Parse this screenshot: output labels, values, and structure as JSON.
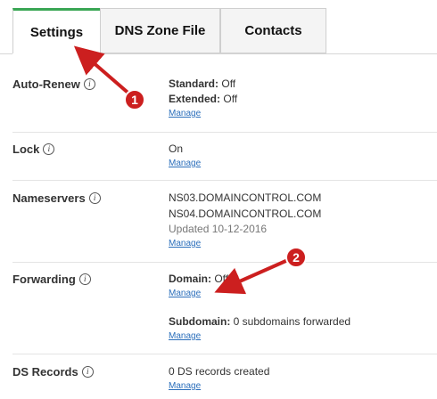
{
  "tabs": [
    {
      "label": "Settings"
    },
    {
      "label": "DNS Zone File"
    },
    {
      "label": "Contacts"
    }
  ],
  "info_glyph": "i",
  "rows": {
    "auto_renew": {
      "label": "Auto-Renew",
      "standard_label": "Standard:",
      "standard_value": "Off",
      "extended_label": "Extended:",
      "extended_value": "Off",
      "manage": "Manage"
    },
    "lock": {
      "label": "Lock",
      "value": "On",
      "manage": "Manage"
    },
    "nameservers": {
      "label": "Nameservers",
      "ns1": "NS03.DOMAINCONTROL.COM",
      "ns2": "NS04.DOMAINCONTROL.COM",
      "updated": "Updated 10-12-2016",
      "manage": "Manage"
    },
    "forwarding": {
      "label": "Forwarding",
      "domain_label": "Domain:",
      "domain_value": "Off",
      "manage1": "Manage",
      "subdomain_label": "Subdomain:",
      "subdomain_value": "0 subdomains forwarded",
      "manage2": "Manage"
    },
    "ds_records": {
      "label": "DS Records",
      "value": "0 DS records created",
      "manage": "Manage"
    }
  },
  "annotations": {
    "marker1": "1",
    "marker2": "2",
    "color": "#cc1f1f"
  },
  "colors": {
    "active_tab_accent": "#39a654",
    "link": "#2a6ebb"
  }
}
